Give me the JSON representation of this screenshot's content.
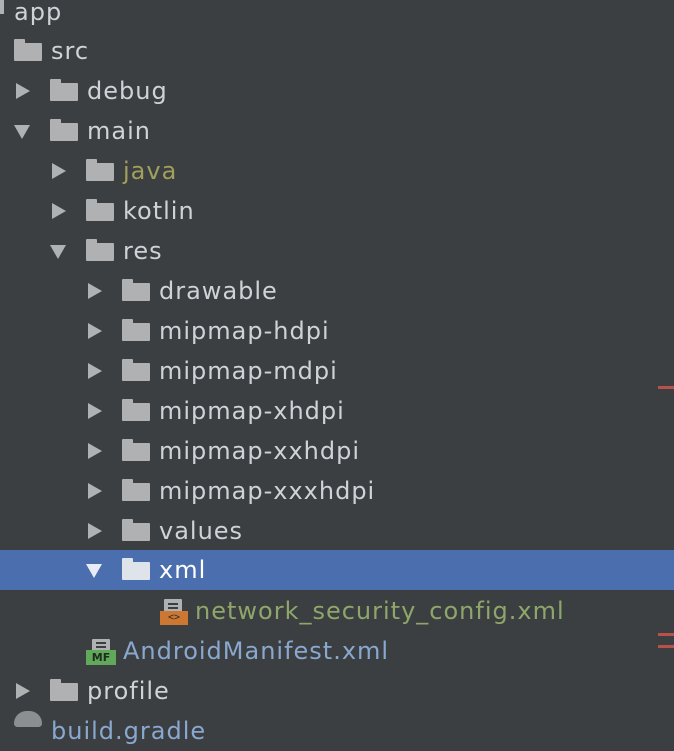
{
  "tree": {
    "items": [
      {
        "label": "app",
        "icon": "folder-icon",
        "state": "expanded"
      },
      {
        "label": "src",
        "icon": "folder-icon",
        "state": "expanded"
      },
      {
        "label": "debug",
        "icon": "folder-icon",
        "state": "collapsed"
      },
      {
        "label": "main",
        "icon": "folder-icon",
        "state": "expanded"
      },
      {
        "label": "java",
        "icon": "folder-icon",
        "state": "collapsed"
      },
      {
        "label": "kotlin",
        "icon": "folder-icon",
        "state": "collapsed"
      },
      {
        "label": "res",
        "icon": "folder-icon",
        "state": "expanded"
      },
      {
        "label": "drawable",
        "icon": "folder-icon",
        "state": "collapsed"
      },
      {
        "label": "mipmap-hdpi",
        "icon": "folder-icon",
        "state": "collapsed"
      },
      {
        "label": "mipmap-mdpi",
        "icon": "folder-icon",
        "state": "collapsed"
      },
      {
        "label": "mipmap-xhdpi",
        "icon": "folder-icon",
        "state": "collapsed"
      },
      {
        "label": "mipmap-xxhdpi",
        "icon": "folder-icon",
        "state": "collapsed"
      },
      {
        "label": "mipmap-xxxhdpi",
        "icon": "folder-icon",
        "state": "collapsed"
      },
      {
        "label": "values",
        "icon": "folder-icon",
        "state": "collapsed"
      },
      {
        "label": "xml",
        "icon": "folder-icon",
        "state": "expanded",
        "selected": true
      },
      {
        "label": "network_security_config.xml",
        "icon": "xml-file-icon",
        "badge": "<>"
      },
      {
        "label": "AndroidManifest.xml",
        "icon": "manifest-file-icon",
        "badge": "MF"
      },
      {
        "label": "profile",
        "icon": "folder-icon",
        "state": "collapsed"
      },
      {
        "label": "build.gradle",
        "icon": "gradle-icon"
      }
    ]
  },
  "colors": {
    "background": "#3c3f41",
    "selection": "#4b6eaf",
    "text": "#cfd2d6",
    "java_text": "#a0a05a",
    "config_text": "#8fa66a",
    "manifest_text": "#8aa8cf",
    "error_mark": "#b9504a"
  }
}
